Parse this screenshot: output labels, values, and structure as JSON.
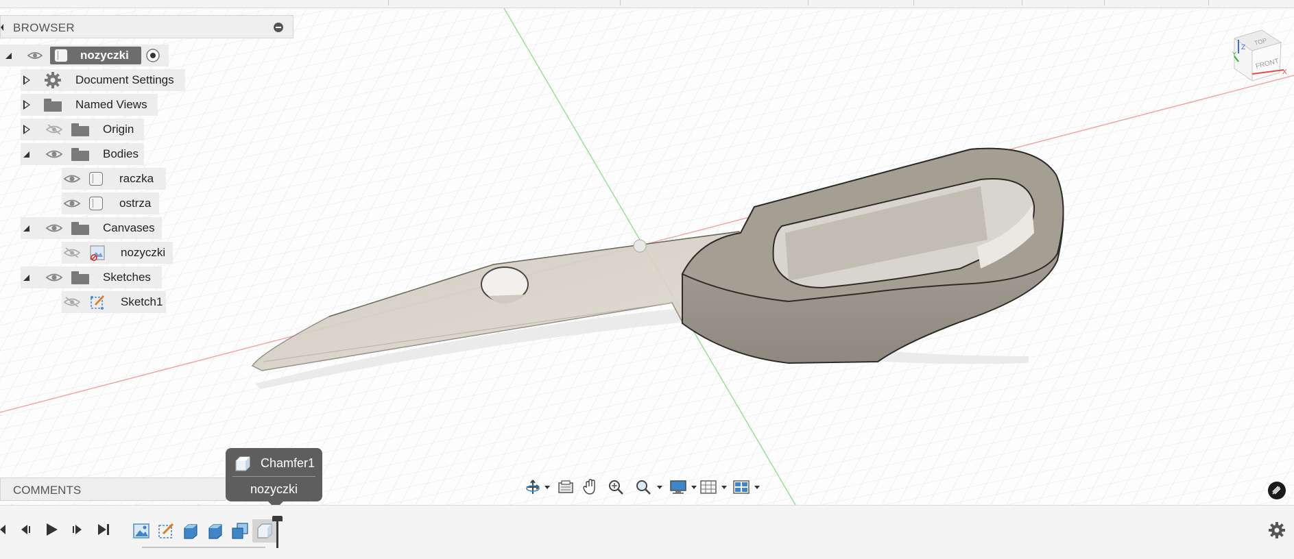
{
  "topbar": {
    "labels": []
  },
  "browser": {
    "title": "BROWSER",
    "items": [
      {
        "label": "nozyczki",
        "kind": "root"
      },
      {
        "label": "Document Settings",
        "kind": "settings"
      },
      {
        "label": "Named Views",
        "kind": "folder"
      },
      {
        "label": "Origin",
        "kind": "folder",
        "visible": false
      },
      {
        "label": "Bodies",
        "kind": "folder"
      },
      {
        "label": "raczka",
        "kind": "body"
      },
      {
        "label": "ostrza",
        "kind": "body"
      },
      {
        "label": "Canvases",
        "kind": "folder"
      },
      {
        "label": "nozyczki",
        "kind": "canvas",
        "visible": false
      },
      {
        "label": "Sketches",
        "kind": "folder"
      },
      {
        "label": "Sketch1",
        "kind": "sketch",
        "visible": false
      }
    ]
  },
  "comments": {
    "title": "COMMENTS"
  },
  "tooltip": {
    "feature": "Chamfer1",
    "component": "nozyczki"
  },
  "viewcube": {
    "top": "TOP",
    "front": "FRONT",
    "axis_z": "Z",
    "axis_x": "X",
    "axis_y": "Y"
  },
  "nav_toolbar": {
    "icons": [
      "orbit-icon",
      "look-at-icon",
      "pan-icon",
      "zoom-window-icon",
      "zoom-icon",
      "display-settings-icon",
      "grid-settings-icon",
      "viewports-icon"
    ]
  },
  "timeline": {
    "controls": [
      "go-to-start",
      "step-back",
      "play",
      "step-forward",
      "go-to-end"
    ],
    "features": [
      "canvas",
      "sketch",
      "extrude",
      "extrude",
      "combine",
      "chamfer"
    ]
  },
  "colors": {
    "accent": "#1e86c8",
    "panel": "#eeeeee",
    "tooltip": "#5e5e5e",
    "model": "#a39e92"
  }
}
